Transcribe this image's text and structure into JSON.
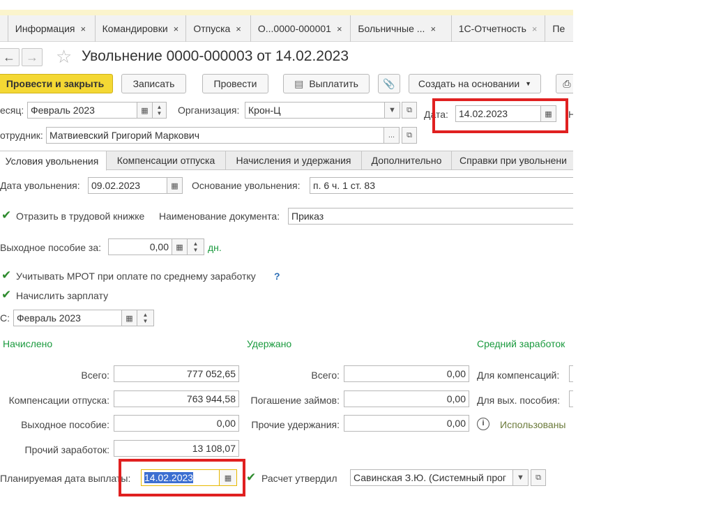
{
  "tabs": [
    {
      "label": "Информация",
      "close": "×"
    },
    {
      "label": "Командировки",
      "close": "×"
    },
    {
      "label": "Отпуска",
      "close": "×"
    },
    {
      "label": "О...0000-000001",
      "close": "×"
    },
    {
      "label": "Больничные ...",
      "close": "×"
    },
    {
      "label": "1С-Отчетность",
      "close": "×"
    },
    {
      "label": "Пе",
      "close": ""
    }
  ],
  "title": "Увольнение 0000-000003 от 14.02.2023",
  "toolbar": {
    "post_close": "Провести и закрыть",
    "save": "Записать",
    "post": "Провести",
    "pay": "Выплатить",
    "create_based": "Создать на основании"
  },
  "header": {
    "month_label": "есяц:",
    "month_value": "Февраль 2023",
    "org_label": "Организация:",
    "org_value": "Крон-Ц",
    "date_label": "Дата:",
    "date_value": "14.02.2023",
    "date_next": "Н",
    "employee_label": "отрудник:",
    "employee_value": "Матвиевский Григорий Маркович"
  },
  "form_tabs": [
    "Условия увольнения",
    "Компенсации отпуска",
    "Начисления и удержания",
    "Дополнительно",
    "Справки при увольнени"
  ],
  "conditions": {
    "dismissal_date_label": "Дата увольнения:",
    "dismissal_date_value": "09.02.2023",
    "reason_label": "Основание увольнения:",
    "reason_value": "п. 6 ч. 1 ст. 83",
    "workbook_label": "Отразить в трудовой книжке",
    "doc_name_label": "Наименование документа:",
    "doc_name_value": "Приказ",
    "severance_label": "Выходное пособие за:",
    "severance_value": "0,00",
    "severance_unit": "дн.",
    "mrot_label": "Учитывать МРОТ при оплате по среднему заработку",
    "help": "?",
    "salary_label": "Начислить зарплату",
    "from_label": "С:",
    "from_value": "Февраль 2023"
  },
  "accrued": {
    "title": "Начислено",
    "total_label": "Всего:",
    "total": "777 052,65",
    "vac_label": "Компенсации отпуска:",
    "vac": "763 944,58",
    "sev_label": "Выходное пособие:",
    "sev": "0,00",
    "other_label": "Прочий заработок:",
    "other": "13 108,07"
  },
  "withheld": {
    "title": "Удержано",
    "total_label": "Всего:",
    "total": "0,00",
    "loans_label": "Погашение займов:",
    "loans": "0,00",
    "other_label": "Прочие удержания:",
    "other": "0,00"
  },
  "average": {
    "title": "Средний заработок",
    "comp_label": "Для компенсаций:",
    "sev_label": "Для вых. пособия:",
    "used_label": "Использованы"
  },
  "payment": {
    "plan_label": "Планируемая дата выплаты:",
    "plan_value": "14.02.2023",
    "approved_label": "Расчет утвердил",
    "approved_value": "Савинская З.Ю. (Системный прог"
  }
}
